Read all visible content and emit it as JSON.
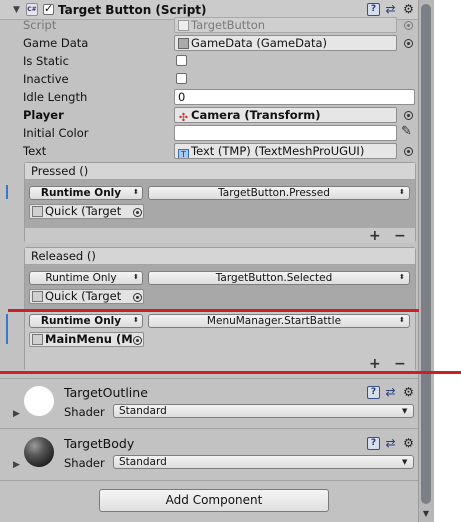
{
  "component": {
    "title": "Target Button (Script)",
    "enabled": true,
    "cs_icon_text": "C#"
  },
  "fields": {
    "script": {
      "label": "Script",
      "value": "TargetButton"
    },
    "game_data": {
      "label": "Game Data",
      "value": "GameData (GameData)"
    },
    "is_static": {
      "label": "Is Static",
      "checked": false
    },
    "inactive": {
      "label": "Inactive",
      "checked": false
    },
    "idle_length": {
      "label": "Idle Length",
      "value": "0"
    },
    "player": {
      "label": "Player",
      "value": "Camera (Transform)"
    },
    "initial_color": {
      "label": "Initial Color",
      "value": "#ffffff"
    },
    "text": {
      "label": "Text",
      "value": "Text (TMP) (TextMeshProUGUI)"
    }
  },
  "events": {
    "pressed": {
      "title": "Pressed ()",
      "listeners": [
        {
          "mode": "Runtime Only",
          "function": "TargetButton.Pressed",
          "object": "Quick (Target"
        }
      ]
    },
    "released": {
      "title": "Released ()",
      "listeners": [
        {
          "mode": "Runtime Only",
          "function": "TargetButton.Selected",
          "object": "Quick (Target"
        },
        {
          "mode": "Runtime Only",
          "function": "MenuManager.StartBattle",
          "object": "MainMenu (M"
        }
      ]
    },
    "plus": "+",
    "minus": "−"
  },
  "materials": [
    {
      "name": "TargetOutline",
      "shader_label": "Shader",
      "shader": "Standard"
    },
    {
      "name": "TargetBody",
      "shader_label": "Shader",
      "shader": "Standard"
    }
  ],
  "add_component_label": "Add Component",
  "colors": {
    "annotation_line": "#cc2027",
    "listener_mark": "#3a79c9"
  }
}
